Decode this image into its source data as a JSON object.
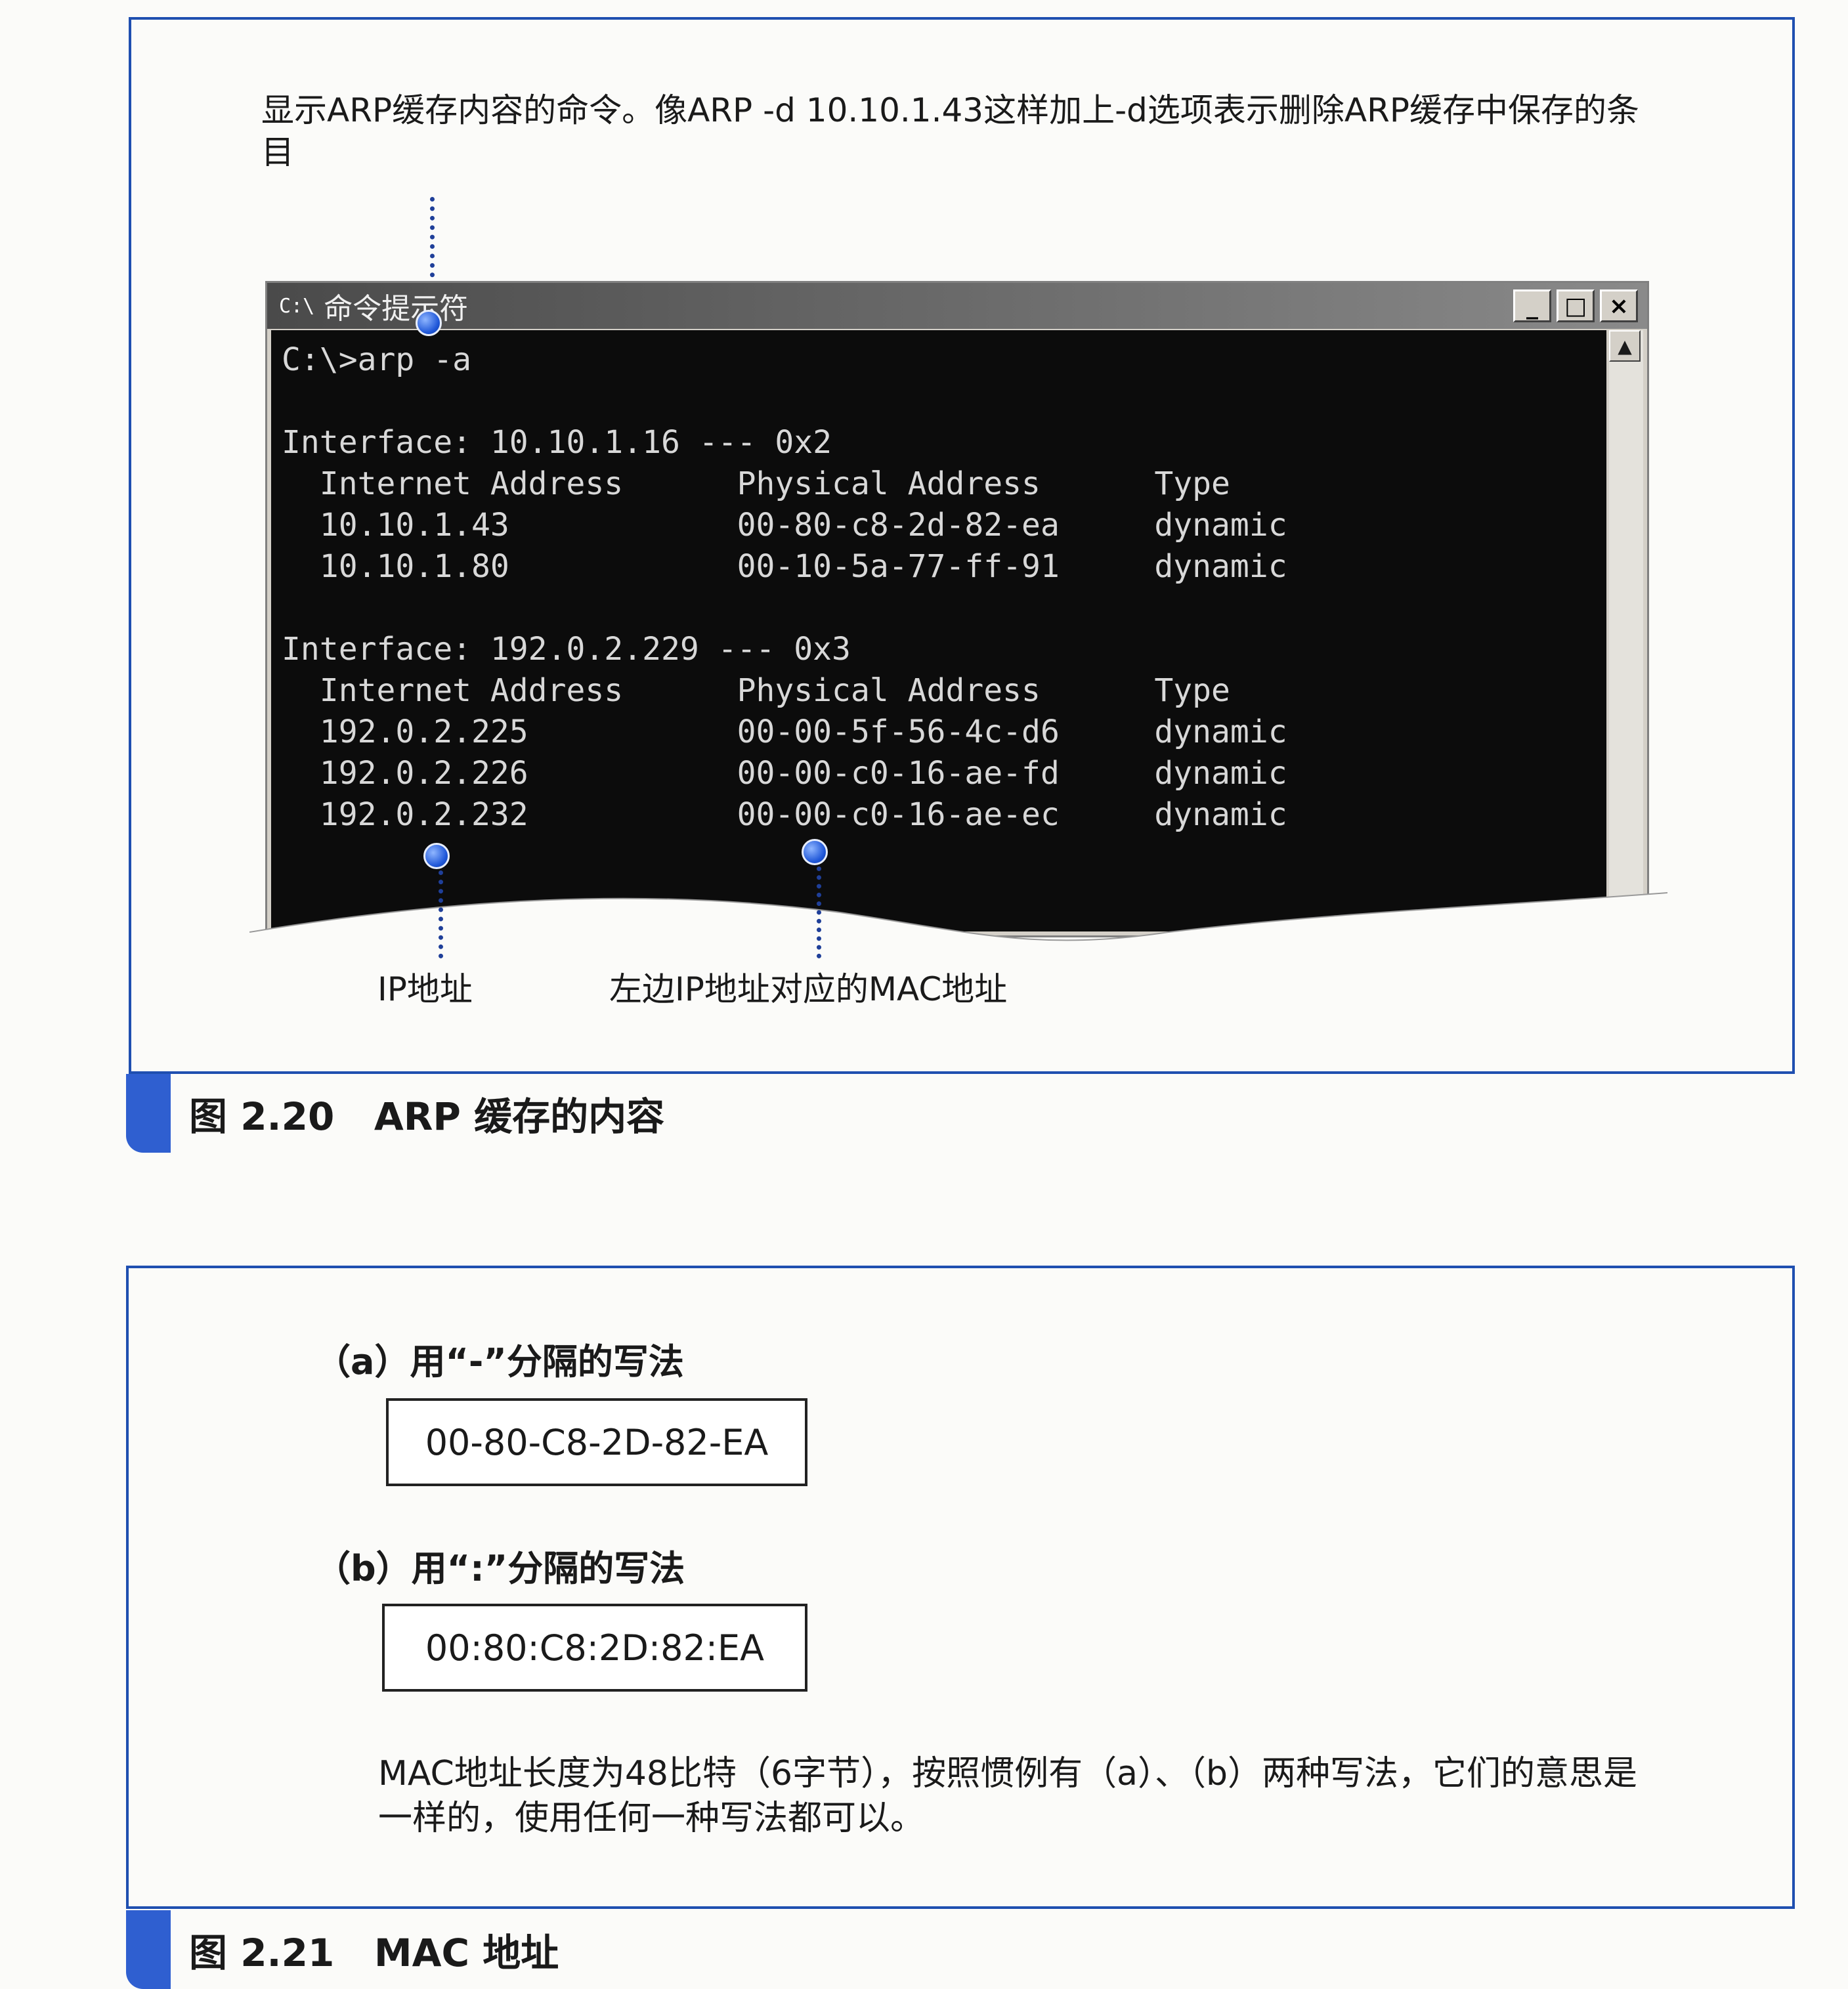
{
  "figure_220": {
    "caption": "图 2.20   ARP 缓存的内容",
    "note_command": "显示ARP缓存内容的命令。像ARP -d 10.10.1.43这样加上-d选项表示删除ARP缓存中保存的条目",
    "note_ip": "IP地址",
    "note_mac": "左边IP地址对应的MAC地址",
    "window": {
      "title": "命令提示符",
      "icon_glyph": "C:\\",
      "minimize": "_",
      "maximize": "□",
      "close": "×",
      "scroll_up": "▲",
      "console_lines": [
        "C:\\>arp -a",
        "",
        "Interface: 10.10.1.16 --- 0x2",
        "  Internet Address      Physical Address      Type",
        "  10.10.1.43            00-80-c8-2d-82-ea     dynamic",
        "  10.10.1.80            00-10-5a-77-ff-91     dynamic",
        "",
        "Interface: 192.0.2.229 --- 0x3",
        "  Internet Address      Physical Address      Type",
        "  192.0.2.225           00-00-5f-56-4c-d6     dynamic",
        "  192.0.2.226           00-00-c0-16-ae-fd     dynamic",
        "  192.0.2.232           00-00-c0-16-ae-ec     dynamic"
      ]
    }
  },
  "figure_221": {
    "caption": "图 2.21   MAC 地址",
    "label_a": "（a）用“-”分隔的写法",
    "mac_a": "00-80-C8-2D-82-EA",
    "label_b": "（b）用“:”分隔的写法",
    "mac_b": "00:80:C8:2D:82:EA",
    "description": "MAC地址长度为48比特（6字节），按照惯例有（a）、（b）两种写法，它们的意思是一样的，使用任何一种写法都可以。"
  },
  "colors": {
    "frame_blue": "#1f4fb0",
    "caption_tab": "#2f5fd0",
    "console_bg": "#0c0c0c",
    "leader_blue": "#1f3f99"
  }
}
